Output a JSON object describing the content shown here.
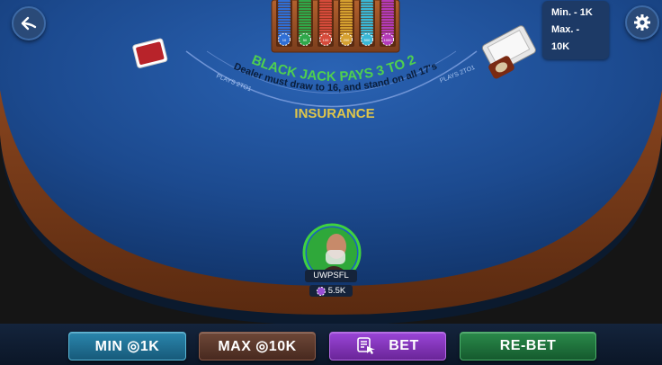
{
  "table": {
    "blackjack_text": "BLACK JACK PAYS 3 TO 2",
    "dealer_rule_text": "Dealer must draw to 16, and stand on all 17's",
    "insurance_text": "INSURANCE",
    "insurance_pays_left": "PLAYS 2TO1",
    "insurance_pays_right": "PLAYS 2TO1",
    "felt_color": "#1c4a8f",
    "rail_color": "#7a3d1c"
  },
  "limits": {
    "min": "Min. - 1K",
    "max": "Max. - 10K"
  },
  "chip_tray": {
    "columns": [
      {
        "color": "#2f6fd6",
        "label": "10"
      },
      {
        "color": "#2fa84a",
        "label": "50"
      },
      {
        "color": "#d64a3a",
        "label": "100"
      },
      {
        "color": "#d6a02f",
        "label": "200"
      },
      {
        "color": "#3ab8d6",
        "label": "500"
      },
      {
        "color": "#b43ab8",
        "label": "1000"
      }
    ]
  },
  "player": {
    "name": "UWPSFL",
    "balance": "5.5K"
  },
  "buttons": {
    "min": "MIN ◎1K",
    "max": "MAX ◎10K",
    "bet": "BET",
    "rebet": "RE-BET"
  },
  "colors": {
    "min_bg": "#1e6a8c",
    "max_bg": "#5a3a2e",
    "bet_bg": "#7a2fb0",
    "rebet_bg": "#1e6a3a"
  }
}
